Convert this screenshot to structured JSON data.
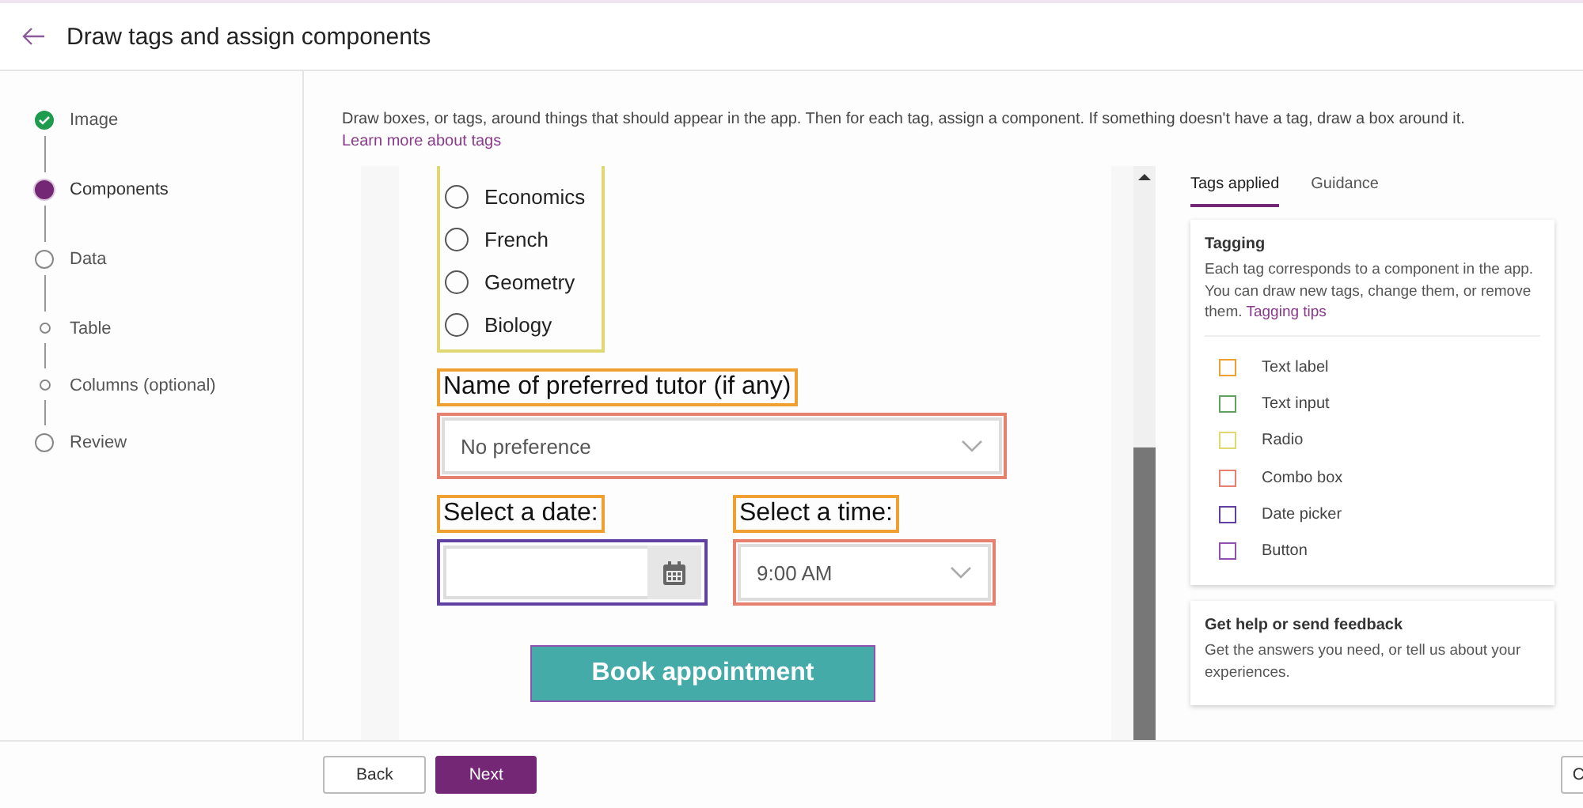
{
  "header": {
    "title": "Draw tags and assign components"
  },
  "steps": [
    {
      "label": "Image",
      "kind": "step",
      "completed": true,
      "selected": false
    },
    {
      "label": "Components",
      "kind": "step",
      "completed": false,
      "selected": true
    },
    {
      "label": "Data",
      "kind": "step",
      "completed": false,
      "selected": false
    },
    {
      "label": "Table",
      "kind": "substep",
      "completed": false,
      "selected": false
    },
    {
      "label": "Columns (optional)",
      "kind": "substep",
      "completed": false,
      "selected": false
    },
    {
      "label": "Review",
      "kind": "step",
      "completed": false,
      "selected": false
    }
  ],
  "intro": {
    "text": "Draw boxes, or tags, around things that should appear in the app. Then for each tag, assign a component. If something doesn't have a tag, draw a box around it.",
    "link": "Learn more about tags"
  },
  "preview": {
    "radio_group": {
      "color": "#e0d870"
    },
    "options": [
      {
        "label": "Economics",
        "selected": false
      },
      {
        "label": "French",
        "selected": false
      },
      {
        "label": "Geometry",
        "selected": false
      },
      {
        "label": "Biology",
        "selected": false
      }
    ],
    "tutor_label": {
      "text": "Name of preferred tutor (if any)",
      "color": "#f0a030"
    },
    "tutor_combo": {
      "value": "No preference",
      "color": "#e88070"
    },
    "date_label": {
      "text": "Select a date:",
      "color": "#f0a030"
    },
    "date_picker": {
      "color": "#6040a0"
    },
    "time_label": {
      "text": "Select a time:",
      "color": "#f0a030"
    },
    "time_combo": {
      "value": "9:00 AM",
      "color": "#e88070"
    },
    "button": {
      "text": "Book appointment",
      "color": "#9050b0"
    }
  },
  "panel": {
    "tabs": [
      {
        "label": "Tags applied",
        "selected": true
      },
      {
        "label": "Guidance",
        "selected": false
      }
    ],
    "tagging": {
      "title": "Tagging",
      "text": "Each tag corresponds to a component in the app. You can draw new tags, change them, or remove them.",
      "link": "Tagging tips",
      "legend": [
        {
          "label": "Text label",
          "color": "#f0a030"
        },
        {
          "label": "Text input",
          "color": "#60a060"
        },
        {
          "label": "Radio",
          "color": "#e0d870"
        },
        {
          "label": "Combo box",
          "color": "#e88070"
        },
        {
          "label": "Date picker",
          "color": "#6040a0"
        },
        {
          "label": "Button",
          "color": "#9050b0"
        }
      ]
    },
    "help": {
      "title": "Get help or send feedback",
      "text": "Get the answers you need, or tell us about your experiences."
    }
  },
  "footer": {
    "back": "Back",
    "next": "Next",
    "right": "C"
  }
}
